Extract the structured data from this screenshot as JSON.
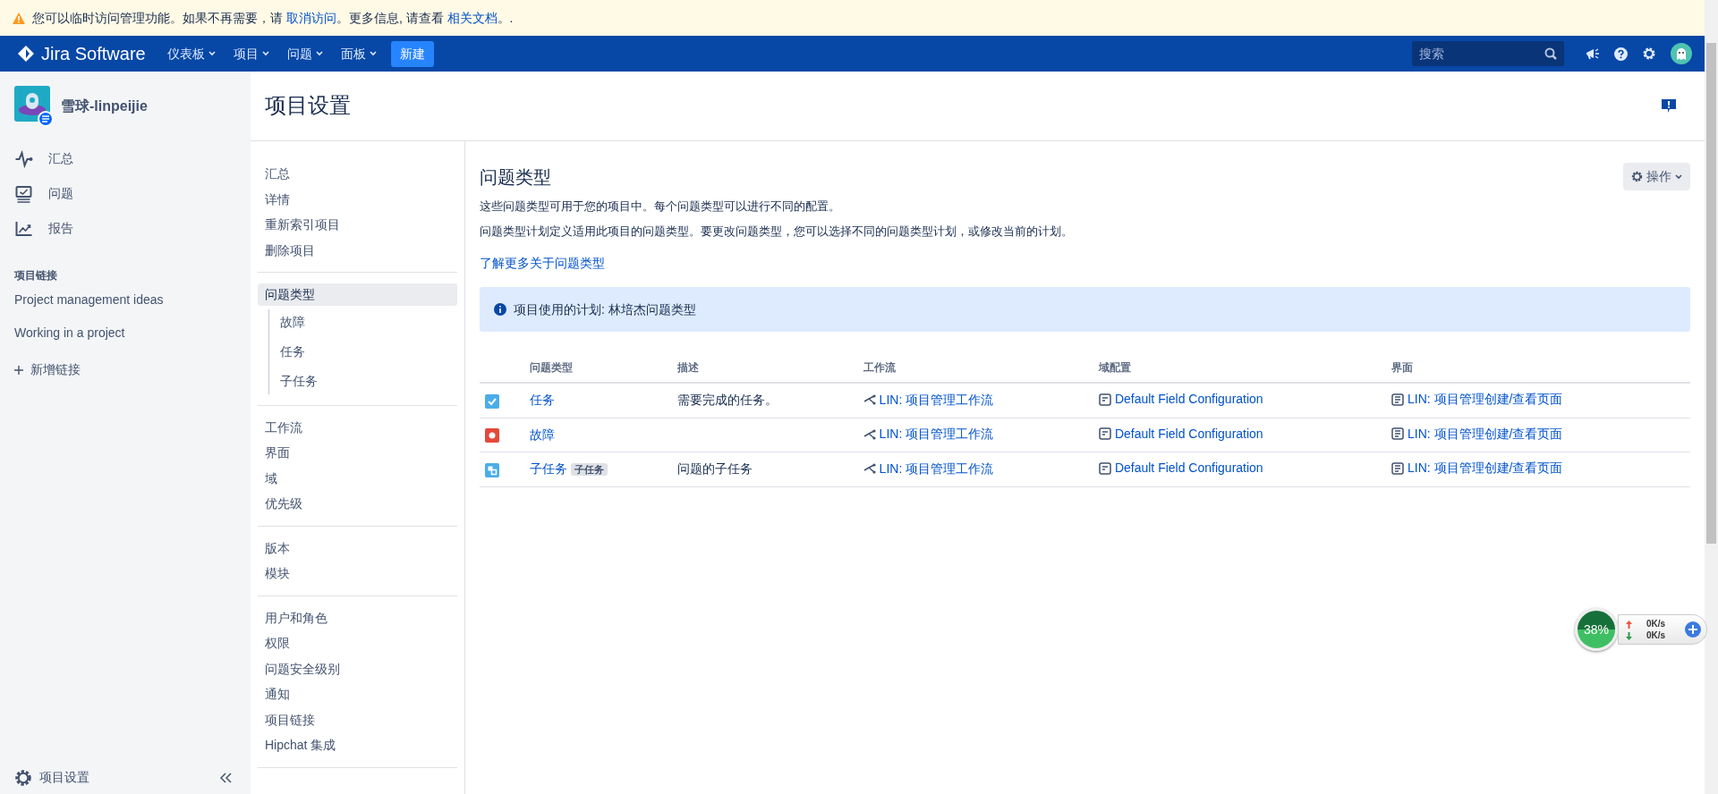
{
  "banner": {
    "segments": [
      {
        "text": "您可以临时访问管理功能。如果不再需要，请 ",
        "link": false
      },
      {
        "text": "取消访问",
        "link": true
      },
      {
        "text": "。更多信息, 请查看 ",
        "link": false
      },
      {
        "text": "相关文档",
        "link": true
      },
      {
        "text": "。.",
        "link": false
      }
    ]
  },
  "navbar": {
    "logo": "Jira Software",
    "menus": [
      "仪表板",
      "项目",
      "问题",
      "面板"
    ],
    "create": "新建",
    "search": {
      "placeholder": "搜索"
    }
  },
  "sidebar": {
    "project_name": "雪球-linpeijie",
    "items": [
      {
        "label": "汇总",
        "kind": "pulse"
      },
      {
        "label": "问题",
        "kind": "monitor"
      },
      {
        "label": "报告",
        "kind": "chart"
      }
    ],
    "section_title": "项目链接",
    "links": [
      "Project management ideas",
      "Working in a project"
    ],
    "add_link": "新增链接",
    "footer": "项目设置"
  },
  "page_title": "项目设置",
  "settings_nav": [
    [
      {
        "label": "汇总",
        "selected": false
      },
      {
        "label": "详情",
        "selected": false
      },
      {
        "label": "重新索引项目",
        "selected": false
      },
      {
        "label": "删除项目",
        "selected": false
      }
    ],
    [
      {
        "label": "问题类型",
        "selected": true,
        "children": [
          {
            "label": "故障",
            "selected": false
          },
          {
            "label": "任务",
            "selected": false
          },
          {
            "label": "子任务",
            "selected": false
          }
        ]
      }
    ],
    [
      {
        "label": "工作流",
        "selected": false
      },
      {
        "label": "界面",
        "selected": false
      },
      {
        "label": "域",
        "selected": false
      },
      {
        "label": "优先级",
        "selected": false
      }
    ],
    [
      {
        "label": "版本",
        "selected": false
      },
      {
        "label": "模块",
        "selected": false
      }
    ],
    [
      {
        "label": "用户和角色",
        "selected": false
      },
      {
        "label": "权限",
        "selected": false
      },
      {
        "label": "问题安全级别",
        "selected": false
      },
      {
        "label": "通知",
        "selected": false
      },
      {
        "label": "项目链接",
        "selected": false
      },
      {
        "label": "Hipchat 集成",
        "selected": false
      }
    ]
  ],
  "content": {
    "title": "问题类型",
    "actions": "操作",
    "descriptions": [
      "这些问题类型可用于您的项目中。每个问题类型可以进行不同的配置。",
      "问题类型计划定义适用此项目的问题类型。要更改问题类型，您可以选择不同的问题类型计划，或修改当前的计划。"
    ],
    "learn_more": "了解更多关于问题类型",
    "info": "项目使用的计划: 林培杰问题类型",
    "table": {
      "columns": [
        "问题类型",
        "描述",
        "工作流",
        "域配置",
        "界面"
      ],
      "rows": [
        {
          "kind": "task",
          "name": "任务",
          "description": "需要完成的任务。",
          "workflow": "LIN: 项目管理工作流",
          "field_config": "Default Field Configuration",
          "screen": "LIN: 项目管理创建/查看页面"
        },
        {
          "kind": "bug",
          "name": "故障",
          "workflow": "LIN: 项目管理工作流",
          "field_config": "Default Field Configuration",
          "screen": "LIN: 项目管理创建/查看页面"
        },
        {
          "kind": "subtask",
          "name": "子任务",
          "tag": "子任务",
          "description": "问题的子任务",
          "workflow": "LIN: 项目管理工作流",
          "field_config": "Default Field Configuration",
          "screen": "LIN: 项目管理创建/查看页面"
        }
      ]
    }
  },
  "monitor_widget": {
    "percent": "38%",
    "upload": "0K/s",
    "download": "0K/s"
  }
}
